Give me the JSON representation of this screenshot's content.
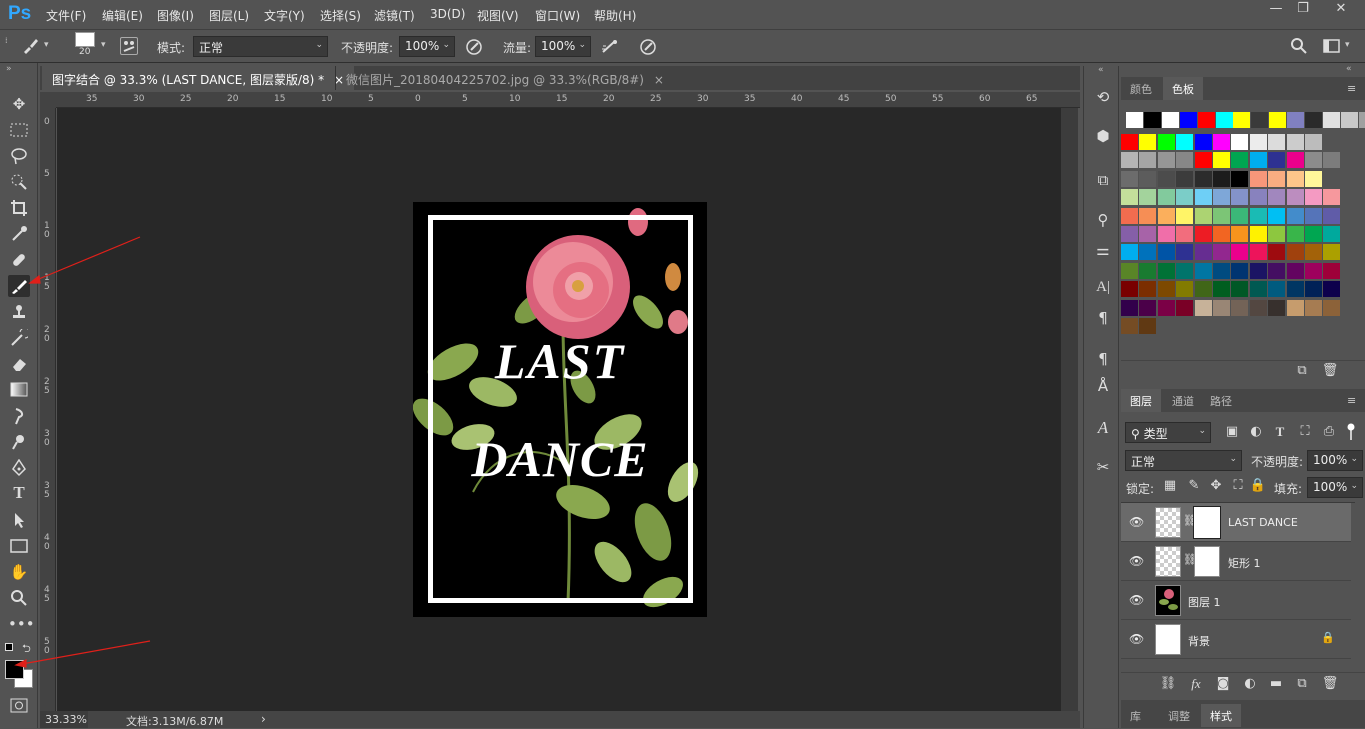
{
  "app": {
    "logo": "Ps",
    "menus": [
      "文件(F)",
      "编辑(E)",
      "图像(I)",
      "图层(L)",
      "文字(Y)",
      "选择(S)",
      "滤镜(T)",
      "3D(D)",
      "视图(V)",
      "窗口(W)",
      "帮助(H)"
    ],
    "window_controls": {
      "minimize": "—",
      "restore": "❐",
      "close": "✕"
    }
  },
  "options": {
    "brush_size": "20",
    "mode_label": "模式:",
    "mode_value": "正常",
    "opacity_label": "不透明度:",
    "opacity_value": "100%",
    "flow_label": "流量:",
    "flow_value": "100%"
  },
  "tabs": [
    {
      "label": "图字结合 @ 33.3% (LAST DANCE, 图层蒙版/8) *",
      "close": "×"
    },
    {
      "label": "微信图片_20180404225702.jpg @ 33.3%(RGB/8#)",
      "close": "×"
    }
  ],
  "rulers": {
    "h": [
      "35",
      "30",
      "25",
      "20",
      "15",
      "10",
      "5",
      "0",
      "5",
      "10",
      "15",
      "20",
      "25",
      "30",
      "35",
      "40",
      "45",
      "50",
      "55",
      "60",
      "65"
    ],
    "v": [
      "0",
      "5",
      "1 0",
      "1 5",
      "2 0",
      "2 5",
      "3 0",
      "3 5",
      "4 0",
      "4 5",
      "5 0"
    ]
  },
  "canvas": {
    "text_line1": "LAST",
    "text_line2": "DANCE"
  },
  "status": {
    "zoom": "33.33%",
    "doc_info": "文档:3.13M/6.87M",
    "arrow": "›"
  },
  "color_panel": {
    "tabs": [
      "颜色",
      "色板"
    ],
    "active": "色板",
    "swatches": [
      [
        "#ffffff",
        "#000000",
        "#ffffff",
        "#0000ff",
        "#ff0000",
        "#00ffff",
        "#ffff00",
        "#3a3a3a",
        "#ffff00",
        "#8080c0",
        "#2a2a2a",
        "#e0e0e0",
        "#c8c8c8",
        "#a0a0a0"
      ],
      [
        "#ff0000",
        "#ffff00",
        "#00ff00",
        "#00ffff",
        "#0000ff",
        "#ff00ff",
        "#ffffff",
        "#ececec",
        "#dcdcdc",
        "#cccccc",
        "#bcbcbc"
      ],
      [
        "#b4b4b4",
        "#a5a5a5",
        "#969696",
        "#878787",
        "#ff0000",
        "#ffff00",
        "#00a651",
        "#00aeef",
        "#2e3192",
        "#ec008c",
        "#8c8c8c",
        "#7c7c7c"
      ],
      [
        "#6c6c6c",
        "#5c5c5c",
        "#4c4c4c",
        "#3c3c3c",
        "#2c2c2c",
        "#1c1c1c",
        "#000000",
        "#f7977a",
        "#f9ad81",
        "#fdc68a",
        "#fff79a"
      ],
      [
        "#c4df9b",
        "#a3d39c",
        "#82ca9d",
        "#7bcdc8",
        "#6ecff6",
        "#7ea7d8",
        "#8493ca",
        "#8882be",
        "#a187be",
        "#bc8dbf",
        "#f49ac2",
        "#f6989d"
      ],
      [
        "#f26c4f",
        "#f68e55",
        "#fbaf5c",
        "#fff467",
        "#acd372",
        "#7cc576",
        "#3bb878",
        "#1abbb4",
        "#00bff3",
        "#438ccb",
        "#5574b9",
        "#605ca8"
      ],
      [
        "#855fa8",
        "#a763a8",
        "#f06ea9",
        "#f26d7d",
        "#ed1c24",
        "#f26522",
        "#f7941d",
        "#fff200",
        "#8dc73f",
        "#39b54a",
        "#00a651",
        "#00a99d"
      ],
      [
        "#00aeef",
        "#0072bc",
        "#0054a6",
        "#2e3192",
        "#662d91",
        "#92278f",
        "#ec008c",
        "#ed145b",
        "#9e0b0f",
        "#a0410d",
        "#a36209",
        "#aba000"
      ],
      [
        "#598527",
        "#197b30",
        "#007236",
        "#00746b",
        "#0076a3",
        "#004b80",
        "#003471",
        "#1b1464",
        "#440e62",
        "#630460",
        "#9e005d",
        "#9e0039"
      ],
      [
        "#790000",
        "#7b2e00",
        "#7d4900",
        "#827b00",
        "#406618",
        "#005e20",
        "#005826",
        "#005952",
        "#005b7f",
        "#003663",
        "#002157",
        "#0d004c"
      ],
      [
        "#32004b",
        "#4b0049",
        "#7b0046",
        "#7a0026",
        "#c7b299",
        "#998675",
        "#736357",
        "#534741",
        "#37302d",
        "#c69c6d",
        "#a67c52",
        "#8c6239"
      ],
      [
        "#754c24",
        "#603913"
      ]
    ]
  },
  "layers_panel": {
    "tabs": [
      "图层",
      "通道",
      "路径"
    ],
    "active": "图层",
    "filter_label": "类型",
    "blend_mode": "正常",
    "opacity_label": "不透明度:",
    "opacity_value": "100%",
    "lock_label": "锁定:",
    "fill_label": "填充:",
    "fill_value": "100%",
    "layers": [
      {
        "name": "LAST DANCE"
      },
      {
        "name": "矩形 1"
      },
      {
        "name": "图层 1"
      },
      {
        "name": "背景"
      }
    ],
    "fx": "fx"
  },
  "bottom_tabs": [
    "库",
    "调整",
    "样式"
  ]
}
